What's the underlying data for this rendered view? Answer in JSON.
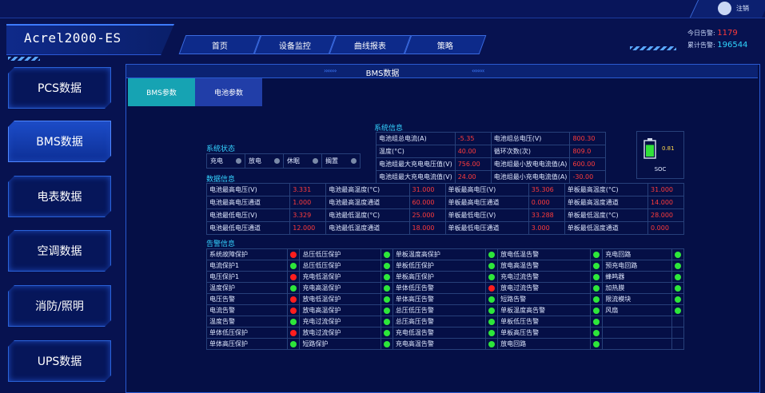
{
  "header": {
    "app_title": "Acrel2000-ES",
    "logout_label": "注销",
    "nav": [
      "首页",
      "设备监控",
      "曲线报表",
      "策略"
    ],
    "stats": {
      "today_alarm_label": "今日告警:",
      "today_alarm_value": "1179",
      "total_alarm_label": "累计告警:",
      "total_alarm_value": "196544"
    }
  },
  "sidebar": {
    "items": [
      {
        "label": "PCS数据",
        "active": false
      },
      {
        "label": "BMS数据",
        "active": true
      },
      {
        "label": "电表数据",
        "active": false
      },
      {
        "label": "空调数据",
        "active": false
      },
      {
        "label": "消防/照明",
        "active": false
      },
      {
        "label": "UPS数据",
        "active": false
      }
    ]
  },
  "main": {
    "title": "BMS数据",
    "tabs": [
      "BMS参数",
      "电池参数"
    ],
    "active_tab": 0
  },
  "system_state": {
    "title": "系统状态",
    "items": [
      "充电",
      "放电",
      "休眠",
      "搁置"
    ]
  },
  "system_info": {
    "title": "系统信息",
    "rows": [
      [
        "电池组总电流(A)",
        "-5.35",
        "电池组总电压(V)",
        "800.30"
      ],
      [
        "温度(°C)",
        "40.00",
        "循环次数(次)",
        "809.0"
      ],
      [
        "电池组最大充电电压值(V)",
        "756.00",
        "电池组最小放电电流值(A)",
        "600.00"
      ],
      [
        "电池组最大充电电流值(V)",
        "24.00",
        "电池组最小充电电流值(A)",
        "-30.00"
      ]
    ]
  },
  "soc": {
    "value": "0.81",
    "label": "SOC"
  },
  "data_info": {
    "title": "数据信息",
    "rows": [
      [
        "电池最高电压(V)",
        "3.331",
        "电池最高温度(°C)",
        "31.000",
        "单板最高电压(V)",
        "35.306",
        "单板最高温度(°C)",
        "31.000"
      ],
      [
        "电池最高电压通道",
        "1.000",
        "电池最高温度通道",
        "60.000",
        "单板最高电压通道",
        "0.000",
        "单板最高温度通道",
        "14.000"
      ],
      [
        "电池最低电压(V)",
        "3.329",
        "电池最低温度(°C)",
        "25.000",
        "单板最低电压(V)",
        "33.288",
        "单板最低温度(°C)",
        "28.000"
      ],
      [
        "电池最低电压通道",
        "12.000",
        "电池最低温度通道",
        "18.000",
        "单板最低电压通道",
        "3.000",
        "单板最低温度通道",
        "0.000"
      ]
    ]
  },
  "alarm_info": {
    "title": "告警信息",
    "colors": {
      "red": "#ff1e1e",
      "green": "#2de63a"
    },
    "rows": [
      [
        [
          "系统故障保护",
          "red"
        ],
        [
          "总压低压保护",
          "green"
        ],
        [
          "单板温度高保护",
          "green"
        ],
        [
          "放电低温告警",
          "green"
        ],
        [
          "充电回路",
          "green"
        ]
      ],
      [
        [
          "电流保护1",
          "green"
        ],
        [
          "总压低压保护",
          "green"
        ],
        [
          "单板低压保护",
          "green"
        ],
        [
          "放电高温告警",
          "green"
        ],
        [
          "预充电回路",
          "green"
        ]
      ],
      [
        [
          "电压保护1",
          "red"
        ],
        [
          "充电低温保护",
          "green"
        ],
        [
          "单板高压保护",
          "green"
        ],
        [
          "充电过流告警",
          "green"
        ],
        [
          "蜂鸣器",
          "green"
        ]
      ],
      [
        [
          "温度保护",
          "green"
        ],
        [
          "充电高温保护",
          "green"
        ],
        [
          "单体低压告警",
          "red"
        ],
        [
          "放电过流告警",
          "green"
        ],
        [
          "加热膜",
          "green"
        ]
      ],
      [
        [
          "电压告警",
          "red"
        ],
        [
          "放电低温保护",
          "green"
        ],
        [
          "单体高压告警",
          "green"
        ],
        [
          "短路告警",
          "green"
        ],
        [
          "限流模块",
          "green"
        ]
      ],
      [
        [
          "电流告警",
          "red"
        ],
        [
          "放电高温保护",
          "green"
        ],
        [
          "总压低压告警",
          "green"
        ],
        [
          "单板温度高告警",
          "green"
        ],
        [
          "风扇",
          "green"
        ]
      ],
      [
        [
          "温度告警",
          "green"
        ],
        [
          "充电过流保护",
          "green"
        ],
        [
          "总压高压告警",
          "green"
        ],
        [
          "单板低压告警",
          "green"
        ],
        [
          "",
          ""
        ]
      ],
      [
        [
          "单体低压保护",
          "red"
        ],
        [
          "放电过流保护",
          "green"
        ],
        [
          "充电低温告警",
          "green"
        ],
        [
          "单板高压告警",
          "green"
        ],
        [
          "",
          ""
        ]
      ],
      [
        [
          "单体高压保护",
          "green"
        ],
        [
          "短路保护",
          "green"
        ],
        [
          "充电高温告警",
          "green"
        ],
        [
          "放电回路",
          "green"
        ],
        [
          "",
          ""
        ]
      ]
    ]
  }
}
